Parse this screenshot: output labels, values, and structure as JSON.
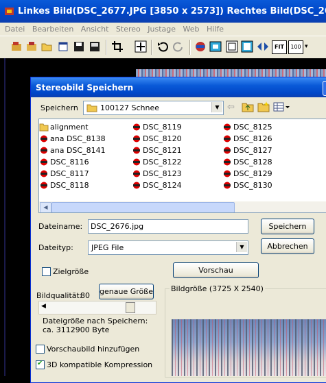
{
  "app": {
    "title": "Linkes Bild(DSC_2677.JPG [3850 x 2573]) Rechtes Bild(DSC_2676.JPG [38",
    "menu": [
      "Datei",
      "Bearbeiten",
      "Ansicht",
      "Stereo",
      "Justage",
      "Web",
      "Hilfe"
    ],
    "toolbar_icons": [
      "open-icon",
      "open-folder-icon",
      "folder-icon",
      "new-window-icon",
      "save-icon",
      "save-as-icon",
      "crop-icon",
      "move-icon",
      "undo-icon",
      "redo-icon",
      "stereo-icon",
      "fit-icon",
      "frame-icon",
      "expand-icon",
      "align-icon",
      "fit-label-icon",
      "zoom-100-icon",
      "dropdown-icon"
    ],
    "toolbar_text": {
      "fit": "FIT",
      "zoom": "100"
    }
  },
  "dialog": {
    "title": "Stereobild Speichern",
    "save_in_label": "Speichern",
    "save_in_value": "100127 Schnee",
    "files": [
      [
        "alignment",
        "ana DSC_8138",
        "ana DSC_8141",
        "DSC_8116",
        "DSC_8117",
        "DSC_8118"
      ],
      [
        "DSC_8119",
        "DSC_8120",
        "DSC_8121",
        "DSC_8122",
        "DSC_8123",
        "DSC_8124"
      ],
      [
        "DSC_8125",
        "DSC_8126",
        "DSC_8127",
        "DSC_8128",
        "DSC_8129",
        "DSC_8130"
      ]
    ],
    "filename_label": "Dateiname:",
    "filename_value": "DSC_2676.jpg",
    "filetype_label": "Dateityp:",
    "filetype_value": "JPEG File",
    "save_button": "Speichern",
    "cancel_button": "Abbrechen",
    "target_size_label": "Zielgröße",
    "preview_button": "Vorschau",
    "quality_label": "Bildqualität:",
    "quality_value": "80",
    "exact_size_button": "genaue Größe",
    "image_size_label": "Bildgröße (3725 X 2540)",
    "filesize_line1": "Dateigröße nach Speichern:",
    "filesize_line2": "ca. 3112900 Byte",
    "thumbnail_label": "Vorschaubild hinzufügen",
    "thumbnail_checked": false,
    "compression_label": "3D kompatible Kompression",
    "compression_checked": true,
    "quality_slider_fraction": 0.8
  }
}
